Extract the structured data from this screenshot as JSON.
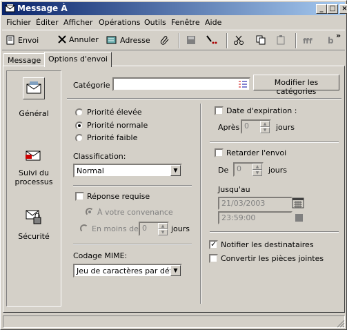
{
  "window": {
    "title": "Message À"
  },
  "menu": [
    "Fichier",
    "Éditer",
    "Afficher",
    "Opérations",
    "Outils",
    "Fenêtre",
    "Aide"
  ],
  "toolbar": {
    "send": "Envoi",
    "cancel": "Annuler",
    "address": "Adresse",
    "more": "»"
  },
  "tabs": [
    "Message",
    "Options d'envoi"
  ],
  "sidebar": [
    {
      "label": "Général",
      "icon": "envelope-general-icon"
    },
    {
      "label": "Suivi du processus",
      "icon": "tracking-icon"
    },
    {
      "label": "Sécurité",
      "icon": "security-lock-icon"
    }
  ],
  "category": {
    "label": "Catégorie",
    "value": "",
    "button": "Modifier les catégories"
  },
  "priority": {
    "high": "Priorité élevée",
    "normal": "Priorité normale",
    "low": "Priorité faible",
    "selected": "normal"
  },
  "classification": {
    "label": "Classification:",
    "value": "Normal"
  },
  "reply": {
    "checkbox": "Réponse requise",
    "at_convenience": "À votre convenance",
    "within": "En moins de",
    "within_value": "0",
    "unit": "jours"
  },
  "mime": {
    "label": "Codage MIME:",
    "value": "Jeu de caractères par défaut"
  },
  "expiration": {
    "checkbox": "Date d'expiration :",
    "after": "Après",
    "value": "0",
    "unit": "jours"
  },
  "delay": {
    "checkbox": "Retarder l'envoi",
    "from": "De",
    "value": "0",
    "unit": "jours",
    "until_label": "Jusqu'au",
    "date": "21/03/2003",
    "time": "23:59:00"
  },
  "notify": {
    "checkbox": "Notifier les destinataires",
    "checked": true
  },
  "convert": {
    "checkbox": "Convertir les pièces jointes",
    "checked": false
  }
}
